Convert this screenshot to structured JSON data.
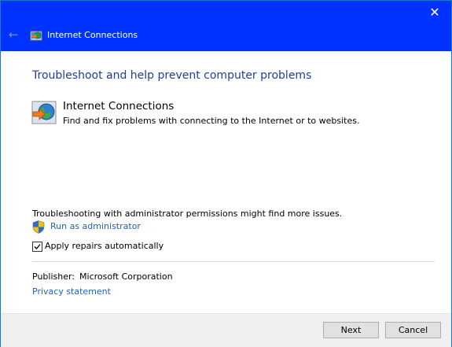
{
  "window": {
    "title": "Internet Connections",
    "close_glyph": "✕",
    "back_glyph": "←"
  },
  "main": {
    "heading": "Troubleshoot and help prevent computer problems",
    "troubleshooter": {
      "icon": "internet-connections-icon",
      "title": "Internet Connections",
      "description": "Find and fix problems with connecting to the Internet or to websites."
    },
    "admin_note": "Troubleshooting with administrator permissions might find more issues.",
    "run_as_admin_label": "Run as administrator",
    "apply_repairs": {
      "label": "Apply repairs automatically",
      "checked": true
    },
    "publisher_label": "Publisher:",
    "publisher_value": "Microsoft Corporation",
    "privacy_label": "Privacy statement"
  },
  "footer": {
    "next_label": "Next",
    "cancel_label": "Cancel"
  },
  "colors": {
    "titlebar": "#0033ff",
    "heading": "#1f3e9a",
    "link": "#1f63b5"
  }
}
